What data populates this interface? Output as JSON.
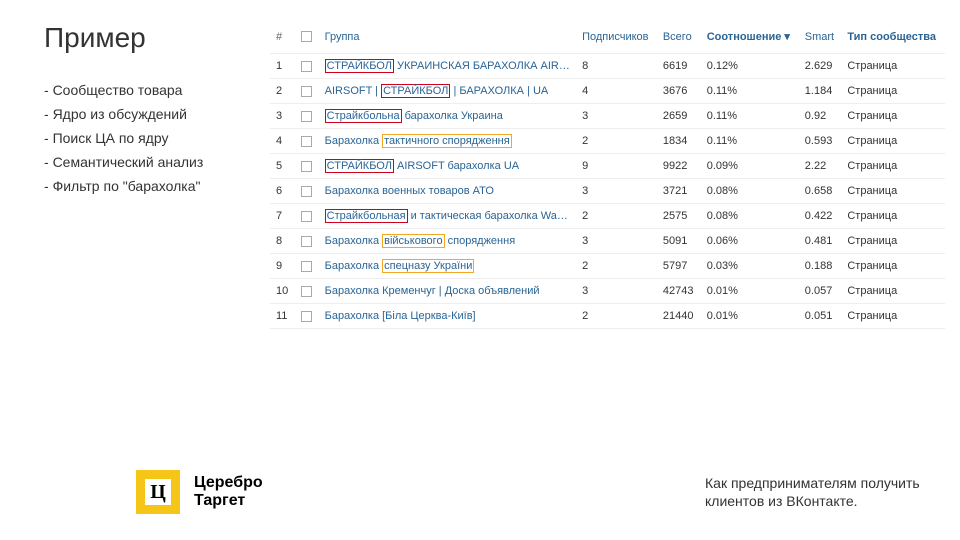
{
  "title": "Пример",
  "bullets": [
    "Сообщество товара",
    "Ядро из обсуждений",
    "Поиск ЦА по ядру",
    "Семантический анализ",
    "Фильтр по \"барахолка\""
  ],
  "table": {
    "headers": {
      "num": "#",
      "group": "Группа",
      "subscribers": "Подписчиков",
      "total": "Всего",
      "ratio": "Соотношение ▾",
      "smart": "Smart",
      "type": "Тип сообщества"
    },
    "rows": [
      {
        "n": "1",
        "subs": "8",
        "total": "6619",
        "ratio": "0.12%",
        "smart": "2.629",
        "type": "Страница"
      },
      {
        "n": "2",
        "subs": "4",
        "total": "3676",
        "ratio": "0.11%",
        "smart": "1.184",
        "type": "Страница"
      },
      {
        "n": "3",
        "subs": "3",
        "total": "2659",
        "ratio": "0.11%",
        "smart": "0.92",
        "type": "Страница"
      },
      {
        "n": "4",
        "subs": "2",
        "total": "1834",
        "ratio": "0.11%",
        "smart": "0.593",
        "type": "Страница"
      },
      {
        "n": "5",
        "subs": "9",
        "total": "9922",
        "ratio": "0.09%",
        "smart": "2.22",
        "type": "Страница"
      },
      {
        "n": "6",
        "subs": "3",
        "total": "3721",
        "ratio": "0.08%",
        "smart": "0.658",
        "type": "Страница"
      },
      {
        "n": "7",
        "subs": "2",
        "total": "2575",
        "ratio": "0.08%",
        "smart": "0.422",
        "type": "Страница"
      },
      {
        "n": "8",
        "subs": "3",
        "total": "5091",
        "ratio": "0.06%",
        "smart": "0.481",
        "type": "Страница"
      },
      {
        "n": "9",
        "subs": "2",
        "total": "5797",
        "ratio": "0.03%",
        "smart": "0.188",
        "type": "Страница"
      },
      {
        "n": "10",
        "subs": "3",
        "total": "42743",
        "ratio": "0.01%",
        "smart": "0.057",
        "type": "Страница"
      },
      {
        "n": "11",
        "subs": "2",
        "total": "21440",
        "ratio": "0.01%",
        "smart": "0.051",
        "type": "Страница"
      }
    ],
    "groups": {
      "r1a": "СТРАЙКБОЛ",
      "r1b": " УКРАИНСКАЯ БАРАХОЛКА AIRSOFT УКРАИНА",
      "r2a": "AIRSOFT | ",
      "r2b": "СТРАЙКБОЛ",
      "r2c": " | БАРАХОЛКА | UA",
      "r3a": "Страйкбольна",
      "r3b": " барахолка Украина",
      "r4a": "Барахолка ",
      "r4b": "тактичного спорядження",
      "r5a": "СТРАЙКБОЛ",
      "r5b": " AIRSOFT барахолка UA",
      "r6": "Барахолка военных товаров АТО",
      "r7a": "Страйкбольная",
      "r7b": " и тактическая барахолка WarKit",
      "r8a": "Барахолка ",
      "r8b": "військового",
      "r8c": " спорядження",
      "r9a": "Барахолка ",
      "r9b": "спецназу України",
      "r10": "Барахолка Кременчуг | Доска объявлений",
      "r11": "Барахолка [Біла Церква-Київ]"
    }
  },
  "logo": {
    "line1": "Церебро",
    "line2": "Таргет",
    "glyph": "Ц"
  },
  "caption": "Как предпринимателям получить клиентов из ВКонтакте."
}
